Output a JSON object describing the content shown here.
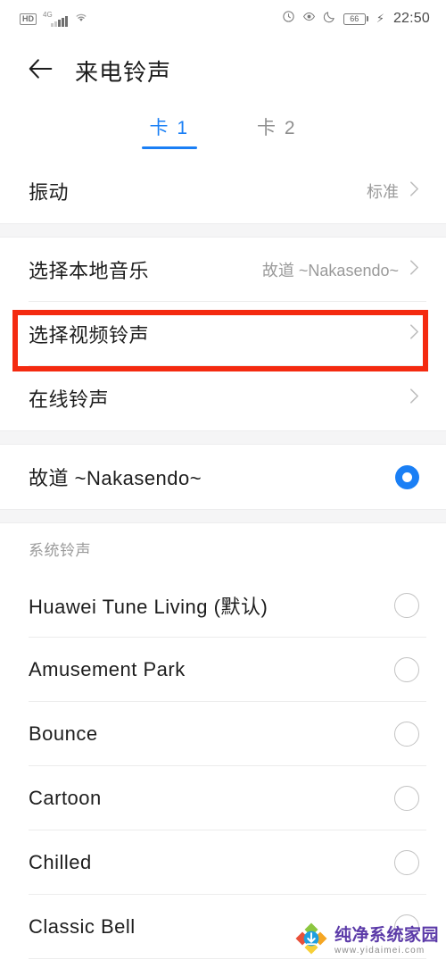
{
  "statusbar": {
    "hd_badge": "HD",
    "network_label": "4G",
    "icons": [
      "hd-badge",
      "signal-4g-icon",
      "wifi-icon",
      "alarm-icon",
      "eye-icon",
      "moon-icon",
      "battery-icon",
      "charging-bolt-icon"
    ],
    "battery_level": "66",
    "time": "22:50"
  },
  "appbar": {
    "back_icon": "back-arrow-icon",
    "title": "来电铃声"
  },
  "tabs": [
    {
      "label": "卡 1",
      "active": true
    },
    {
      "label": "卡 2",
      "active": false
    }
  ],
  "settings": {
    "vibrate": {
      "label": "振动",
      "value": "标准"
    },
    "local_music": {
      "label": "选择本地音乐",
      "value": "故道 ~Nakasendo~"
    },
    "video_ringtone": {
      "label": "选择视频铃声",
      "value": ""
    },
    "online_ringtone": {
      "label": "在线铃声",
      "value": ""
    }
  },
  "current_selection": {
    "label": "故道 ~Nakasendo~",
    "selected": true
  },
  "system_section": {
    "header": "系统铃声",
    "items": [
      {
        "label": "Huawei Tune Living (默认)",
        "selected": false
      },
      {
        "label": "Amusement Park",
        "selected": false
      },
      {
        "label": "Bounce",
        "selected": false
      },
      {
        "label": "Cartoon",
        "selected": false
      },
      {
        "label": "Chilled",
        "selected": false
      },
      {
        "label": "Classic Bell",
        "selected": false
      }
    ]
  },
  "highlight": {
    "target": "选择视频铃声",
    "color": "#f42a10"
  },
  "watermark": {
    "title": "纯净系统家园",
    "url": "www.yidaimei.com"
  },
  "colors": {
    "accent": "#1a7ff5",
    "highlight": "#f42a10",
    "background": "#ffffff",
    "separator": "#f5f5f6"
  }
}
